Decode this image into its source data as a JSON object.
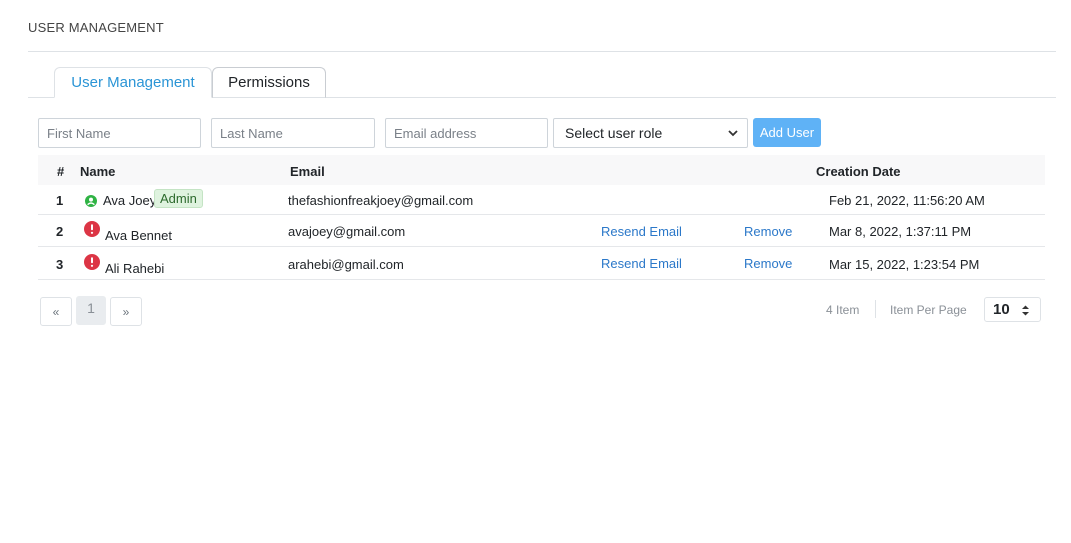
{
  "header": {
    "title": "USER MANAGEMENT"
  },
  "tabs": [
    {
      "label": "User Management",
      "active": true
    },
    {
      "label": "Permissions",
      "active": false
    }
  ],
  "form": {
    "first_name_placeholder": "First Name",
    "last_name_placeholder": "Last Name",
    "email_placeholder": "Email address",
    "role_select_value": "Select user role",
    "add_button_label": "Add User"
  },
  "table": {
    "columns": {
      "num": "#",
      "name": "Name",
      "email": "Email",
      "created": "Creation Date"
    },
    "rows": [
      {
        "num": "1",
        "name": "Ava Joey",
        "badge": "Admin",
        "email": "thefashionfreakjoey@gmail.com",
        "resend": "",
        "remove": "",
        "created": "Feb 21, 2022, 11:56:20 AM",
        "status_icon": "user-check-icon",
        "status_color": "#2fb344"
      },
      {
        "num": "2",
        "name": "Ava Bennet",
        "badge": "",
        "email": "avajoey@gmail.com",
        "resend": "Resend Email",
        "remove": "Remove",
        "created": "Mar 8, 2022, 1:37:11 PM",
        "status_icon": "error-icon",
        "status_color": "#dc3545"
      },
      {
        "num": "3",
        "name": "Ali Rahebi",
        "badge": "",
        "email": "arahebi@gmail.com",
        "resend": "Resend Email",
        "remove": "Remove",
        "created": "Mar 15, 2022, 1:23:54 PM",
        "status_icon": "error-icon",
        "status_color": "#dc3545"
      }
    ]
  },
  "pagination": {
    "prev": "«",
    "current": "1",
    "next": "»",
    "item_count": "4 Item",
    "per_page_label": "Item Per Page",
    "per_page_value": "10"
  },
  "colors": {
    "accent": "#2b95d6",
    "button": "#5fb2f6",
    "link": "#2b78c9"
  }
}
